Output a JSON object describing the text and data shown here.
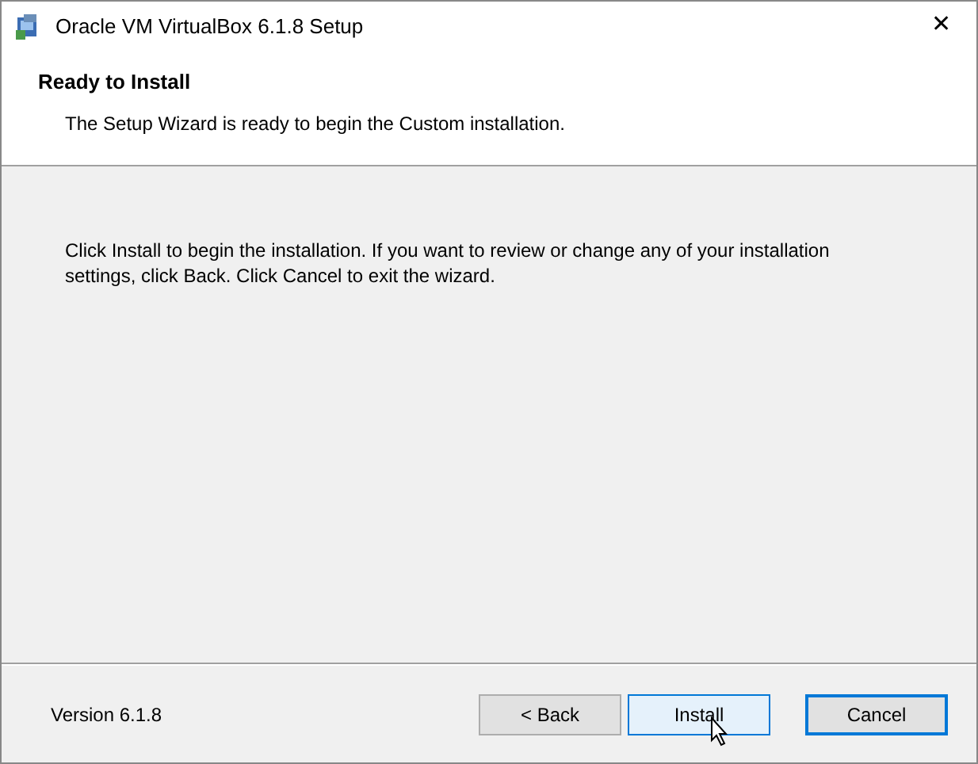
{
  "window": {
    "title": "Oracle VM VirtualBox 6.1.8 Setup",
    "close": "✕"
  },
  "header": {
    "title": "Ready to Install",
    "subtitle": "The Setup Wizard is ready to begin the Custom installation."
  },
  "body": {
    "text": "Click Install to begin the installation. If you want to review or change any of your installation settings, click Back. Click Cancel to exit the wizard."
  },
  "footer": {
    "version": "Version 6.1.8"
  },
  "buttons": [
    {
      "label": "< Back",
      "hovered": false,
      "default": false
    },
    {
      "label": "Install",
      "hovered": true,
      "default": false
    },
    {
      "label": "Cancel",
      "hovered": false,
      "default": true
    }
  ]
}
